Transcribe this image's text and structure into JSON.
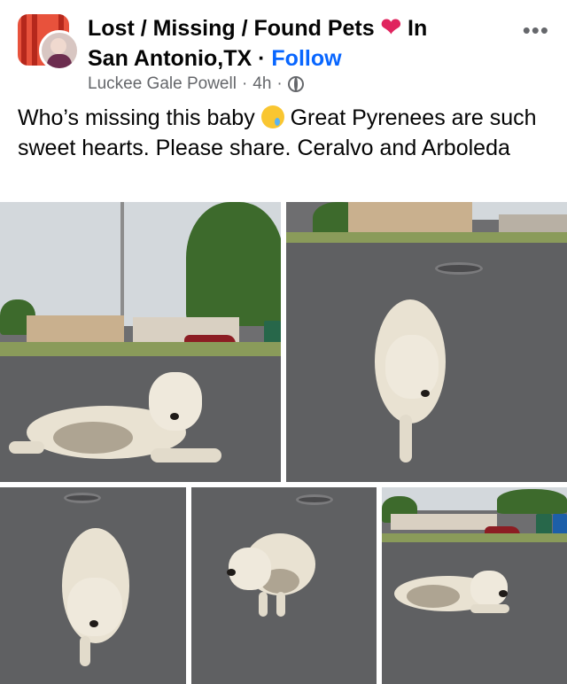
{
  "post": {
    "group_title_line1": "Lost / Missing / Found Pets",
    "group_title_in": "In",
    "group_title_line2": "San Antonio,TX",
    "separator": "·",
    "follow_label": "Follow",
    "author": "Luckee Gale Powell",
    "time": "4h",
    "more_icon": "•••",
    "text_part1": "Who’s missing this baby",
    "text_part2": "Great Pyrenees are such sweet hearts. Please share. Ceralvo and Arboleda"
  },
  "icons": {
    "heart": "heart-icon",
    "globe": "globe-icon",
    "more": "more-options-icon",
    "emoji": "crying-face-emoji"
  },
  "colors": {
    "link": "#0866ff",
    "meta": "#65676b",
    "heart": "#e0245e",
    "text": "#050505"
  }
}
